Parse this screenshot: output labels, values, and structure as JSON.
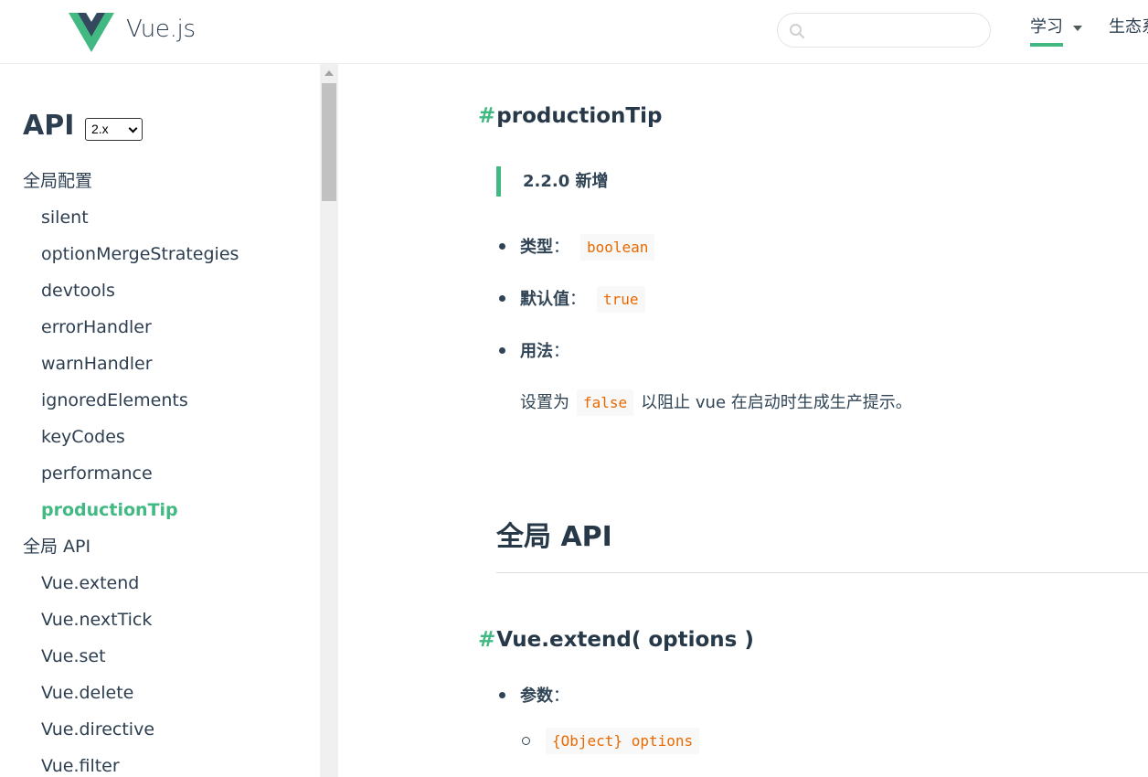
{
  "header": {
    "brand": "Vue.js",
    "search_placeholder": "",
    "nav_learn": "学习",
    "nav_ecosystem": "生态系统",
    "accent_color": "#42b983"
  },
  "sidebar": {
    "title": "API",
    "version_selected": "2.x",
    "menu": [
      {
        "label": "全局配置",
        "level": "section"
      },
      {
        "label": "silent",
        "level": "sub"
      },
      {
        "label": "optionMergeStrategies",
        "level": "sub"
      },
      {
        "label": "devtools",
        "level": "sub"
      },
      {
        "label": "errorHandler",
        "level": "sub"
      },
      {
        "label": "warnHandler",
        "level": "sub"
      },
      {
        "label": "ignoredElements",
        "level": "sub"
      },
      {
        "label": "keyCodes",
        "level": "sub"
      },
      {
        "label": "performance",
        "level": "sub"
      },
      {
        "label": "productionTip",
        "level": "sub",
        "active": true
      },
      {
        "label": "全局 API",
        "level": "section"
      },
      {
        "label": "Vue.extend",
        "level": "sub"
      },
      {
        "label": "Vue.nextTick",
        "level": "sub"
      },
      {
        "label": "Vue.set",
        "level": "sub"
      },
      {
        "label": "Vue.delete",
        "level": "sub"
      },
      {
        "label": "Vue.directive",
        "level": "sub"
      },
      {
        "label": "Vue.filter",
        "level": "sub"
      }
    ]
  },
  "content": {
    "section1": {
      "hash": "#",
      "title": "productionTip",
      "tip": "2.2.0 新增",
      "type_label": "类型",
      "type_value": "boolean",
      "default_label": "默认值",
      "default_value": "true",
      "usage_label": "用法",
      "usage_prefix": "设置为",
      "usage_code": "false",
      "usage_suffix": "以阻止 vue 在启动时生成生产提示。",
      "colon": "："
    },
    "h2": "全局 API",
    "section2": {
      "hash": "#",
      "title": "Vue.extend( options )",
      "params_label": "参数",
      "param1": "{Object} options"
    }
  }
}
